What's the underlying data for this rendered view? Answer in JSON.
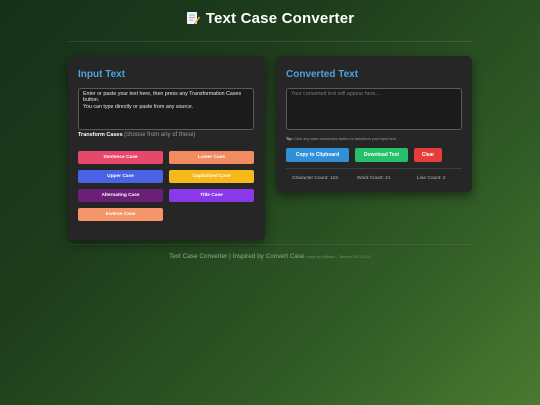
{
  "header": {
    "title": "Text Case Converter",
    "icon": "memo-icon"
  },
  "input_panel": {
    "title": "Input Text",
    "text": "Enter or paste your text here, then press any Transformation Cases button.\nYou can type directly or paste from any source.",
    "transform_label": "Transform Cases",
    "transform_hint": "(choose from any of these)",
    "buttons": {
      "sentence": "Sentence Case",
      "lower": "Lower Case",
      "upper": "Upper Case",
      "capitalized": "Capitalized Case",
      "alternating": "Alternating Case",
      "title": "Title Case",
      "inverse": "Inverse Case"
    }
  },
  "output_panel": {
    "title": "Converted Text",
    "placeholder": "Your converted text will appear here...",
    "tip_label": "Tip:",
    "tip_text": "Click any case conversion button to transform your input text.",
    "actions": {
      "copy": "Copy to Clipboard",
      "download": "Download Text",
      "clear": "Clear"
    },
    "stats": {
      "characters": "Character Count: 122",
      "words": "Word Count: 21",
      "lines": "Line Count: 2"
    }
  },
  "footer": {
    "text": "Text Case Converter | Inspired by Convert Case",
    "small": "made by William L. Barnes 2023-2024"
  },
  "colors": {
    "accent": "#4ea3e0",
    "sentence": "#e6486b",
    "lower": "#f28a62",
    "upper": "#4a63e6",
    "capitalized": "#f7b81a",
    "alternating": "#6c1f78",
    "title": "#8a38e8",
    "inverse": "#f5956a",
    "copy": "#2f8fd8",
    "download": "#27c06a",
    "clear": "#e53c3c"
  }
}
